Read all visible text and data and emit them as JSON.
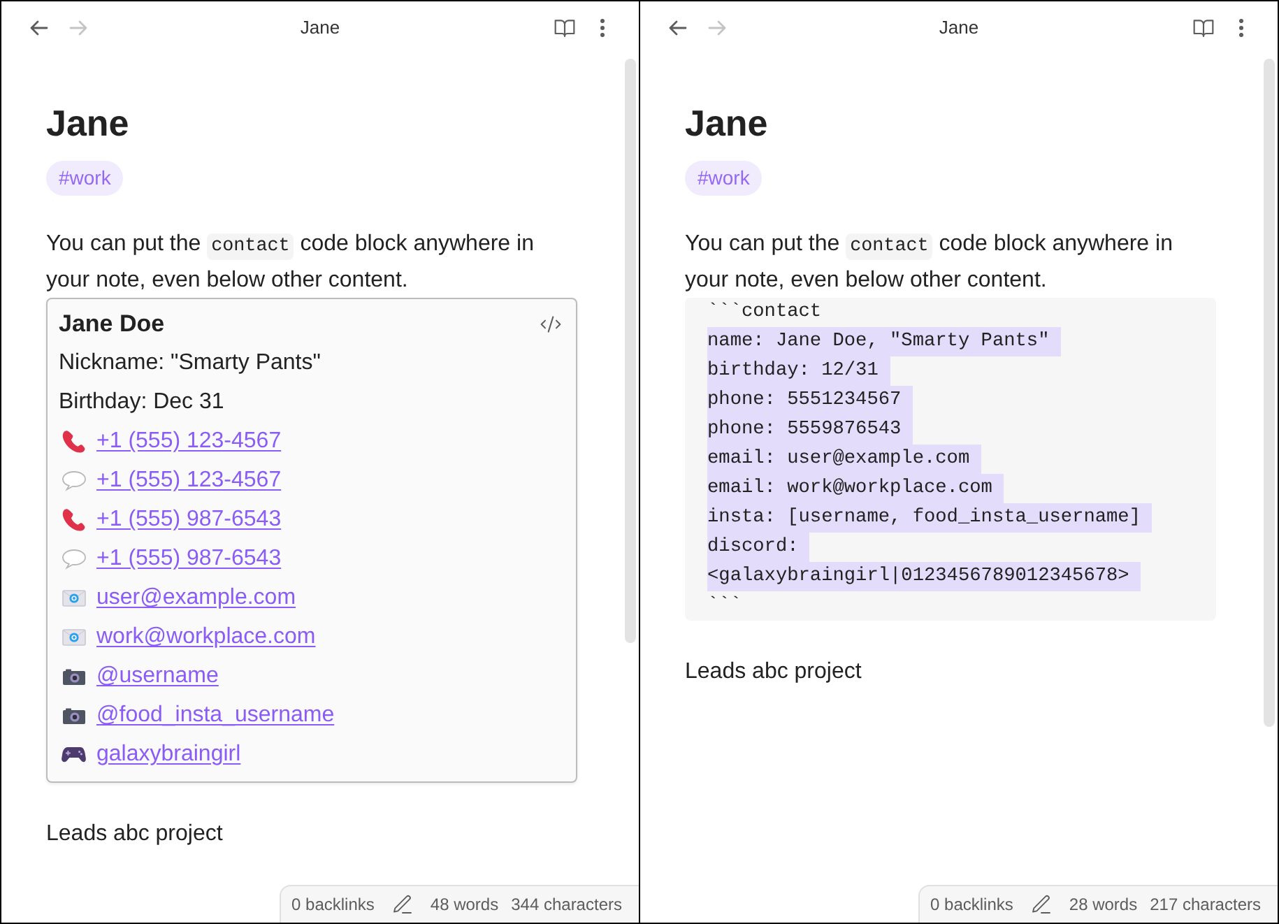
{
  "panes": [
    {
      "header": {
        "title": "Jane",
        "nav": [
          {
            "kind": "back",
            "disabled": false
          },
          {
            "kind": "forward",
            "disabled": true
          }
        ]
      },
      "heading": "Jane",
      "tags": [
        "#work"
      ],
      "blocks": [
        {
          "kind": "paragraph",
          "parts": [
            {
              "kind": "text",
              "text": "You can put the "
            },
            {
              "kind": "code",
              "text": "contact"
            },
            {
              "kind": "text",
              "text": " code block anywhere in your note, even below other content."
            }
          ]
        },
        {
          "kind": "contact_card",
          "name": "Jane Doe",
          "fields": [
            "Nickname: \"Smarty Pants\"",
            "Birthday: Dec 31"
          ],
          "links": [
            {
              "kind": "phone",
              "text": "+1 (555) 123-4567"
            },
            {
              "kind": "message",
              "text": "+1 (555) 123-4567"
            },
            {
              "kind": "phone",
              "text": "+1 (555) 987-6543"
            },
            {
              "kind": "message",
              "text": "+1 (555) 987-6543"
            },
            {
              "kind": "email",
              "text": "user@example.com"
            },
            {
              "kind": "email",
              "text": "work@workplace.com"
            },
            {
              "kind": "camera",
              "text": "@username"
            },
            {
              "kind": "camera",
              "text": "@food_insta_username"
            },
            {
              "kind": "gamepad",
              "text": "galaxybraingirl"
            }
          ]
        },
        {
          "kind": "paragraph",
          "parts": [
            {
              "kind": "text",
              "text": "Leads abc project"
            }
          ]
        }
      ],
      "status_bar": {
        "backlinks": "0 backlinks",
        "words": "48 words",
        "characters": "344 characters"
      }
    },
    {
      "header": {
        "title": "Jane",
        "nav": [
          {
            "kind": "back",
            "disabled": false
          },
          {
            "kind": "forward",
            "disabled": true
          }
        ]
      },
      "heading": "Jane",
      "tags": [
        "#work"
      ],
      "blocks": [
        {
          "kind": "paragraph",
          "parts": [
            {
              "kind": "text",
              "text": "You can put the "
            },
            {
              "kind": "code",
              "text": "contact"
            },
            {
              "kind": "text",
              "text": " code block anywhere in your note, even below other content."
            }
          ]
        },
        {
          "kind": "code_block",
          "lines": [
            {
              "text": "```contact",
              "highlighted": false
            },
            {
              "text": "name: Jane Doe, \"Smarty Pants\"",
              "highlighted": true
            },
            {
              "text": "birthday: 12/31",
              "highlighted": true
            },
            {
              "text": "phone: 5551234567",
              "highlighted": true
            },
            {
              "text": "phone: 5559876543",
              "highlighted": true
            },
            {
              "text": "email: user@example.com",
              "highlighted": true
            },
            {
              "text": "email: work@workplace.com",
              "highlighted": true
            },
            {
              "text": "insta: [username, food_insta_username]",
              "highlighted": true
            },
            {
              "text": "discord:",
              "highlighted": true
            },
            {
              "text": "<galaxybraingirl|0123456789012345678>",
              "highlighted": true
            },
            {
              "text": "```",
              "highlighted": false
            }
          ]
        },
        {
          "kind": "paragraph",
          "parts": [
            {
              "kind": "text",
              "text": "Leads abc project"
            }
          ]
        }
      ],
      "status_bar": {
        "backlinks": "0 backlinks",
        "words": "28 words",
        "characters": "217 characters"
      }
    }
  ]
}
